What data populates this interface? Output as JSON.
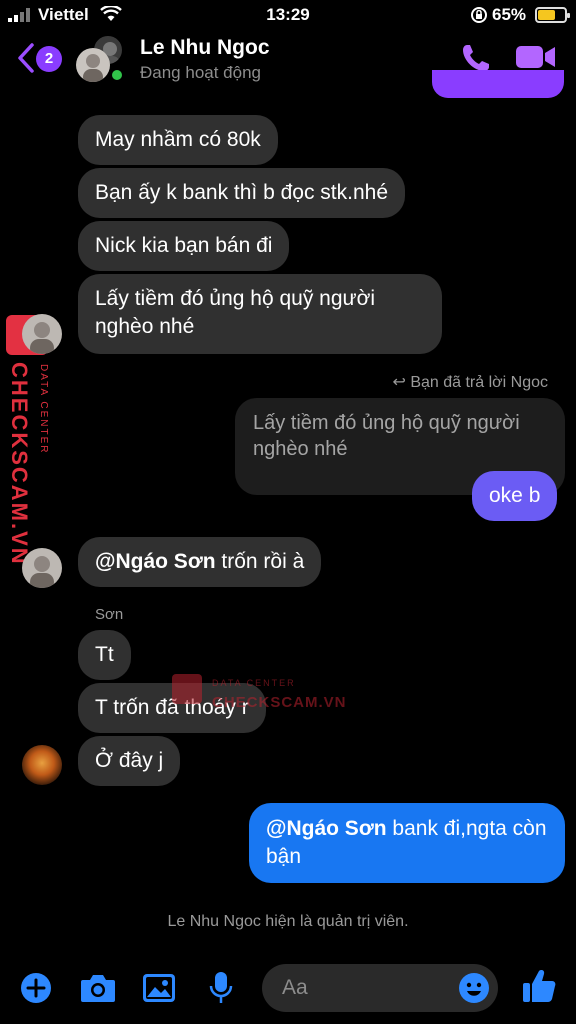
{
  "status_bar": {
    "carrier": "Viettel",
    "time": "13:29",
    "battery_percent": "65%",
    "battery_level": 0.65,
    "icons": [
      "signal-icon",
      "wifi-icon",
      "orientation-lock-icon",
      "battery-icon"
    ]
  },
  "header": {
    "unread_count": "2",
    "contact_name": "Le Nhu Ngoc",
    "contact_status": "Đang hoạt động",
    "icons": [
      "back-icon",
      "phone-icon",
      "video-call-icon"
    ],
    "accent": "#8a3dff"
  },
  "messages": {
    "m1": "May nhầm có 80k",
    "m2": "Bạn ấy k bank thì b đọc stk.nhé",
    "m3": "Nick kia bạn bán đi",
    "m4": "Lấy tiềm đó ủng hộ quỹ người nghèo nhé",
    "reply_note": "Bạn đã trả lời Ngoc",
    "quoted": "Lấy tiềm đó ủng hộ quỹ người nghèo nhé",
    "my_reply": "oke b",
    "m5_mention": "@Ngáo Sơn",
    "m5_rest": " trốn rồi à",
    "sender_son": "Sơn",
    "m6": "Tt",
    "m7": "T trốn đã thoáy r",
    "m8": "Ở đây j",
    "m9_mention": "@Ngáo Sơn",
    "m9_rest": " bank đi,ngta còn bận",
    "system": "Le Nhu Ngoc hiện là quản trị viên."
  },
  "watermark": {
    "brand": "CHECKSCAM.VN",
    "sub": "DATA CENTER"
  },
  "composer": {
    "placeholder": "Aa",
    "icons": [
      "plus-icon",
      "camera-icon",
      "gallery-icon",
      "mic-icon",
      "emoji-icon",
      "thumbs-up-icon"
    ],
    "accent": "#2d88ff"
  },
  "colors": {
    "background": "#000000",
    "incoming_bubble": "#303030",
    "outgoing_purple": "#6b5cf4",
    "outgoing_blue": "#1877f2",
    "online": "#31c44a",
    "watermark_red": "#e0303e"
  }
}
